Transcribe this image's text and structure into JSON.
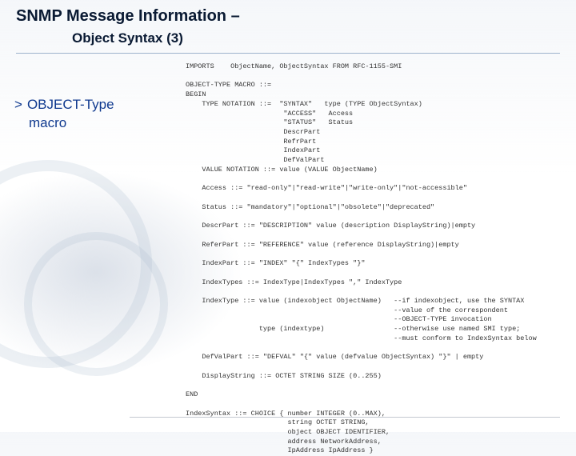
{
  "header": {
    "title": "SNMP Message Information –",
    "subtitle": "Object Syntax (3)"
  },
  "sidenote": {
    "marker": ">",
    "line1": "OBJECT-Type",
    "line2": "macro"
  },
  "code": {
    "l01": "IMPORTS    ObjectName, ObjectSyntax FROM RFC-1155-SMI",
    "l02": "",
    "l03": "OBJECT-TYPE MACRO ::=",
    "l04": "BEGIN",
    "l05": "    TYPE NOTATION ::=  \"SYNTAX\"   type (TYPE ObjectSyntax)",
    "l06": "                        \"ACCESS\"   Access",
    "l07": "                        \"STATUS\"   Status",
    "l08": "                        DescrPart",
    "l09": "                        RefrPart",
    "l10": "                        IndexPart",
    "l11": "                        DefValPart",
    "l12": "    VALUE NOTATION ::= value (VALUE ObjectName)",
    "l13": "",
    "l14": "    Access ::= \"read-only\"|\"read-write\"|\"write-only\"|\"not-accessible\"",
    "l15": "",
    "l16": "    Status ::= \"mandatory\"|\"optional\"|\"obsolete\"|\"deprecated\"",
    "l17": "",
    "l18": "    DescrPart ::= \"DESCRIPTION\" value (description DisplayString)|empty",
    "l19": "",
    "l20": "    ReferPart ::= \"REFERENCE\" value (reference DisplayString)|empty",
    "l21": "",
    "l22": "    IndexPart ::= \"INDEX\" \"{\" IndexTypes \"}\"",
    "l23": "",
    "l24": "    IndexTypes ::= IndexType|IndexTypes \",\" IndexType",
    "l25": "",
    "l26": "    IndexType ::= value (indexobject ObjectName)   --if indexobject, use the SYNTAX",
    "l27": "                                                   --value of the correspondent",
    "l28": "                                                   --OBJECT-TYPE invocation",
    "l29": "                  type (indextype)                 --otherwise use named SMI type;",
    "l30": "                                                   --must conform to IndexSyntax below",
    "l31": "",
    "l32": "    DefValPart ::= \"DEFVAL\" \"{\" value (defvalue ObjectSyntax) \"}\" | empty",
    "l33": "",
    "l34": "    DisplayString ::= OCTET STRING SIZE (0..255)",
    "l35": "",
    "l36": "END",
    "l37": "",
    "l38": "IndexSyntax ::= CHOICE { number INTEGER (0..MAX),",
    "l39": "                         string OCTET STRING,",
    "l40": "                         object OBJECT IDENTIFIER,",
    "l41": "                         address NetworkAddress,",
    "l42": "                         IpAddress IpAddress }"
  }
}
